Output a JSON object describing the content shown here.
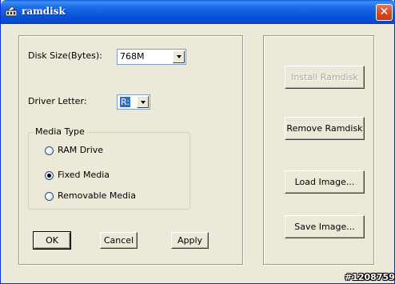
{
  "window": {
    "title": "ramdisk",
    "close_glyph": "✕"
  },
  "disk_size": {
    "label": "Disk Size(Bytes):",
    "value": "768M"
  },
  "driver_letter": {
    "label": "Driver Letter:",
    "value": "R:"
  },
  "media_type": {
    "title": "Media Type",
    "options": [
      {
        "label": "RAM Drive",
        "checked": false
      },
      {
        "label": "Fixed Media",
        "checked": true
      },
      {
        "label": "Removable Media",
        "checked": false
      }
    ]
  },
  "dialog_buttons": {
    "ok": "OK",
    "cancel": "Cancel",
    "apply": "Apply"
  },
  "side_buttons": {
    "install": "Install Ramdisk",
    "remove": "Remove Ramdisk",
    "load": "Load Image...",
    "save": "Save Image..."
  },
  "watermark": "#1208759",
  "icons": {
    "app": "ramdisk-app-icon",
    "close": "close-icon",
    "dropdown": "chevron-down-icon"
  }
}
